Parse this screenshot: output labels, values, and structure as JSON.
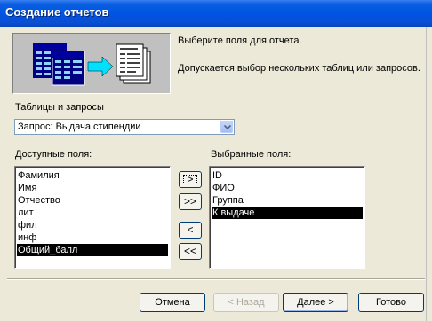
{
  "window": {
    "title": "Создание отчетов"
  },
  "intro": {
    "line1": "Выберите поля для отчета.",
    "line2": "Допускается выбор нескольких таблиц или запросов."
  },
  "source": {
    "label": "Таблицы и запросы",
    "selected": "Запрос: Выдача стипендии"
  },
  "available": {
    "label": "Доступные поля:",
    "items": [
      "Фамилия",
      "Имя",
      "Отчество",
      "лит",
      "фил",
      "инф",
      "Общий_балл"
    ],
    "selected_index": 6
  },
  "chosen": {
    "label": "Выбранные поля:",
    "items": [
      "ID",
      "ФИО",
      "Группа",
      "К выдаче"
    ],
    "selected_index": 3
  },
  "move_buttons": {
    "add_one": ">",
    "add_all": ">>",
    "remove_one": "<",
    "remove_all": "<<"
  },
  "footer": {
    "cancel": "Отмена",
    "back": "< Назад",
    "next": "Далее >",
    "finish": "Готово"
  },
  "colors": {
    "titlebar": "#0054e3",
    "selection": "#000000",
    "face": "#ece9d8"
  }
}
